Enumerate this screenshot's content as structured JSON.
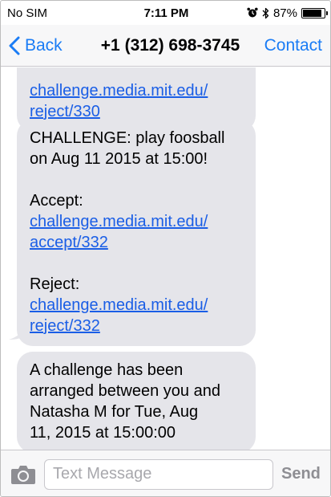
{
  "status_bar": {
    "carrier": "No SIM",
    "time": "7:11 PM",
    "battery_text": "87%",
    "battery_level": 0.87
  },
  "nav": {
    "back_label": "Back",
    "title": "+1 (312) 698-3745",
    "contact_label": "Contact",
    "accent_color": "#1a7cf5"
  },
  "messages": [
    {
      "link_1": "challenge.media.mit.edu/",
      "link_2": "reject/330"
    },
    {
      "text_line_1": "CHALLENGE: play foosball",
      "text_line_2": "on Aug 11 2015 at 15:00!",
      "accept_label": "Accept:",
      "accept_link_1": "challenge.media.mit.edu/",
      "accept_link_2": "accept/332",
      "reject_label": "Reject:",
      "reject_link_1": "challenge.media.mit.edu/",
      "reject_link_2": "reject/332"
    },
    {
      "line_1": "A challenge has been",
      "line_2": "arranged between you and",
      "line_3": "Natasha M for Tue, Aug",
      "line_4": "11, 2015 at 15:00:00"
    }
  ],
  "input": {
    "placeholder": "Text Message",
    "send_label": "Send",
    "camera_icon": "camera-icon"
  }
}
